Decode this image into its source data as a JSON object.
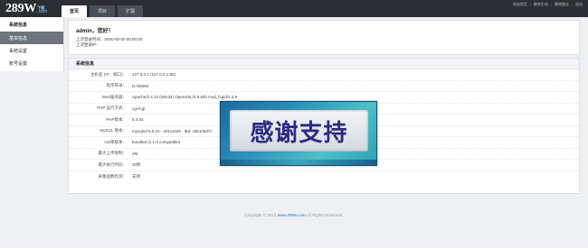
{
  "logo": {
    "main": "289W",
    "badge": "下载",
    "com": ".com"
  },
  "tabs": [
    "首页",
    "项目",
    "扩展"
  ],
  "toplinks": [
    "网站首页",
    "静态生成",
    "删除缓存",
    "退出"
  ],
  "sidebar": {
    "title": "系统信息",
    "items": [
      "基本信息",
      "系统设置",
      "账号设置"
    ]
  },
  "welcome": {
    "greeting": "admin，您好！",
    "last_login_time": "上次登录时间：0000-00-00 00:00:00",
    "last_login_ip": "上次登录IP："
  },
  "info": {
    "title": "系统信息",
    "rows": [
      {
        "key": "主机名 (IP：端口)：",
        "value": "127.0.0.1 (127.0.0.1:80)"
      },
      {
        "key": "程序目录：",
        "value": "D:/WWW"
      },
      {
        "key": "Web服务器：",
        "value": "Apache/2.4.10 (Win32) OpenSSL/0.9.8zb mod_fcgid/2.3.9"
      },
      {
        "key": "PHP 运行方式：",
        "value": "cgi-fcgi"
      },
      {
        "key": "PHP版本：",
        "value": "5.4.33"
      },
      {
        "key": "MySQL 版本：",
        "value": "mysqlnd 5.0.10 - 20111026 - $Id: c85105d7c"
      },
      {
        "key": "GD库版本：",
        "value": "bundled (2.1.0 compatible)"
      },
      {
        "key": "最大上传限制：",
        "value": "2M"
      },
      {
        "key": "最大执行时间：",
        "value": "30秒"
      },
      {
        "key": "采集函数检测：",
        "value": "支持"
      }
    ]
  },
  "banner": {
    "text": "感谢支持"
  },
  "footer": {
    "prefix": "Copyright © 2014 ",
    "link": "www.289w.com",
    "suffix": " All Rights Reserved."
  }
}
